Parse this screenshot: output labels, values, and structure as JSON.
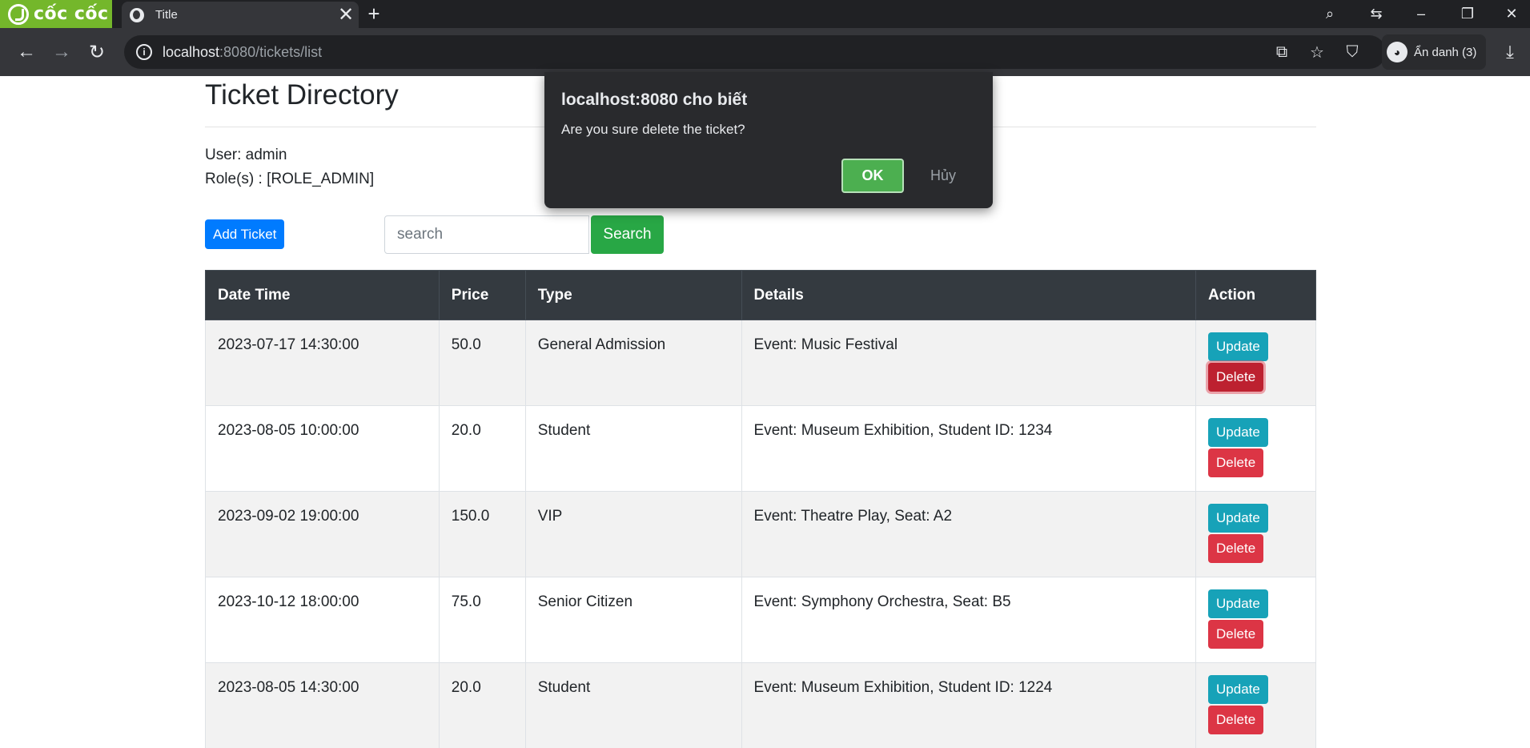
{
  "browser": {
    "brand": "cốc cốc",
    "tab_title": "Title",
    "tab_close": "✕",
    "new_tab": "+",
    "url_host": "localhost",
    "url_rest": ":8080/tickets/list",
    "profile_label": "Ẩn danh (3)"
  },
  "page": {
    "title": "Ticket Directory",
    "user_line": "User: admin",
    "role_line": "Role(s) : [ROLE_ADMIN]",
    "add_button": "Add Ticket",
    "search_placeholder": "search",
    "search_button": "Search"
  },
  "table": {
    "headers": [
      "Date Time",
      "Price",
      "Type",
      "Details",
      "Action"
    ],
    "rows": [
      {
        "datetime": "2023-07-17 14:30:00",
        "price": "50.0",
        "type": "General Admission",
        "details": "Event: Music Festival"
      },
      {
        "datetime": "2023-08-05 10:00:00",
        "price": "20.0",
        "type": "Student",
        "details": "Event: Museum Exhibition, Student ID: 1234"
      },
      {
        "datetime": "2023-09-02 19:00:00",
        "price": "150.0",
        "type": "VIP",
        "details": "Event: Theatre Play, Seat: A2"
      },
      {
        "datetime": "2023-10-12 18:00:00",
        "price": "75.0",
        "type": "Senior Citizen",
        "details": "Event: Symphony Orchestra, Seat: B5"
      },
      {
        "datetime": "2023-08-05 14:30:00",
        "price": "20.0",
        "type": "Student",
        "details": "Event: Museum Exhibition, Student ID: 1224"
      }
    ],
    "update_label": "Update",
    "delete_label": "Delete"
  },
  "dialog": {
    "title": "localhost:8080 cho biết",
    "message": "Are you sure delete the ticket?",
    "ok_label": "OK",
    "cancel_label": "Hủy"
  },
  "colors": {
    "primary": "#007bff",
    "success": "#28a745",
    "info": "#17a2b8",
    "danger": "#dc3545",
    "table_header": "#343a40"
  }
}
